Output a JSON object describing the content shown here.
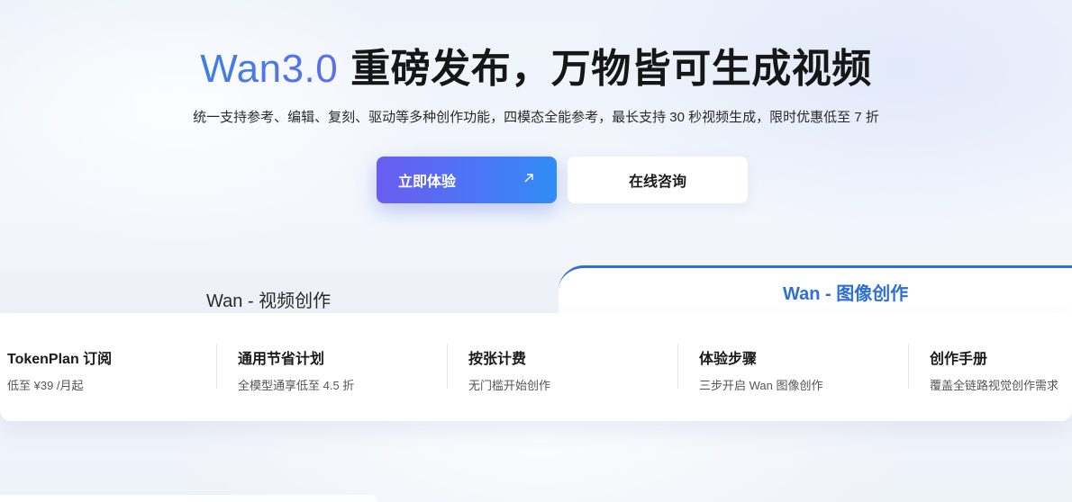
{
  "hero": {
    "brand": "Wan3.0",
    "title_rest": "重磅发布，万物皆可生成视频",
    "subtitle": "统一支持参考、编辑、复刻、驱动等多种创作功能，四模态全能参考，最长支持 30 秒视频生成，限时优惠低至 7 折",
    "primary_button": "立即体验",
    "primary_button_icon": "arrow-up-right-icon",
    "secondary_button": "在线咨询"
  },
  "tabs": [
    {
      "label": "Wan - 视频创作",
      "active": false
    },
    {
      "label": "Wan - 图像创作",
      "active": true
    }
  ],
  "cards": [
    {
      "title": "TokenPlan 订阅",
      "desc": "低至 ¥39 /月起"
    },
    {
      "title": "通用节省计划",
      "desc": "全模型通享低至 4.5 折"
    },
    {
      "title": "按张计费",
      "desc": "无门槛开始创作"
    },
    {
      "title": "体验步骤",
      "desc": "三步开启 Wan 图像创作"
    },
    {
      "title": "创作手册",
      "desc": "覆盖全链路视觉创作需求"
    }
  ],
  "colors": {
    "accent": "#2c6fd8",
    "primary_gradient_start": "#6a5cf0",
    "primary_gradient_end": "#2f8cf7"
  }
}
